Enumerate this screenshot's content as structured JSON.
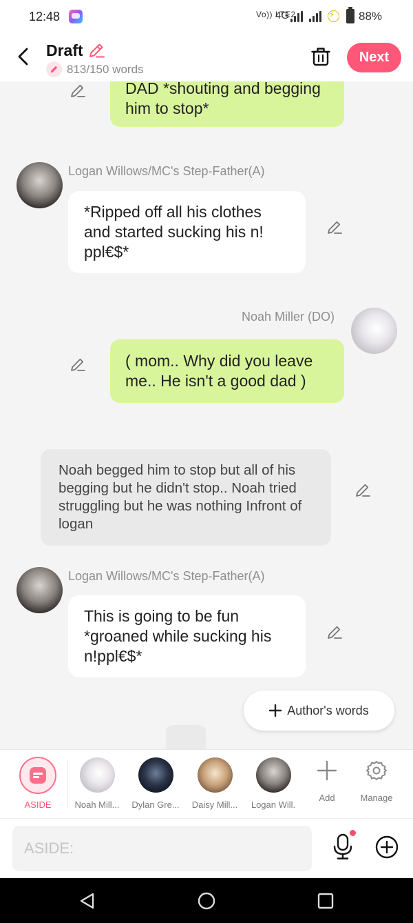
{
  "status_bar": {
    "time": "12:48",
    "network_label": "VoLTE2",
    "network_type": "4G",
    "battery_percent": "88%"
  },
  "header": {
    "title": "Draft",
    "word_count": "813/150 words",
    "next_label": "Next",
    "accent_color": "#ff5777"
  },
  "messages": [
    {
      "type": "player",
      "text": "DAD *shouting and begging him to stop*"
    },
    {
      "type": "character",
      "speaker": "Logan Willows/MC's Step-Father(A)",
      "text": "*Ripped off all his clothes and started sucking his n! ppl€$*"
    },
    {
      "type": "player",
      "speaker": "Noah Miller (DO)",
      "text": "( mom.. Why did you leave me.. He isn't a good dad )"
    },
    {
      "type": "narration",
      "text": "Noah begged him to stop but all of his begging but he didn't stop.. Noah tried struggling but he was nothing Infront of logan"
    },
    {
      "type": "character",
      "speaker": "Logan Willows/MC's Step-Father(A)",
      "text": "This is going to be fun *groaned while sucking his n!ppl€$*"
    }
  ],
  "authors_words_label": "Author's words",
  "character_bar": {
    "items": [
      {
        "label": "ASIDE",
        "icon": "aside-icon",
        "selected": true
      },
      {
        "label": "Noah Mill...",
        "icon": "avatar-noah"
      },
      {
        "label": "Dylan Gre...",
        "icon": "avatar-dylan"
      },
      {
        "label": "Daisy Mill...",
        "icon": "avatar-daisy"
      },
      {
        "label": "Logan Will.",
        "icon": "avatar-logan"
      }
    ],
    "add_label": "Add",
    "manage_label": "Manage"
  },
  "input": {
    "placeholder": "ASIDE:",
    "value": ""
  },
  "colors": {
    "player_bubble": "#d9f59b",
    "character_bubble": "#ffffff",
    "narration_bubble": "#e9e9e9",
    "background": "#f4f4f4"
  }
}
